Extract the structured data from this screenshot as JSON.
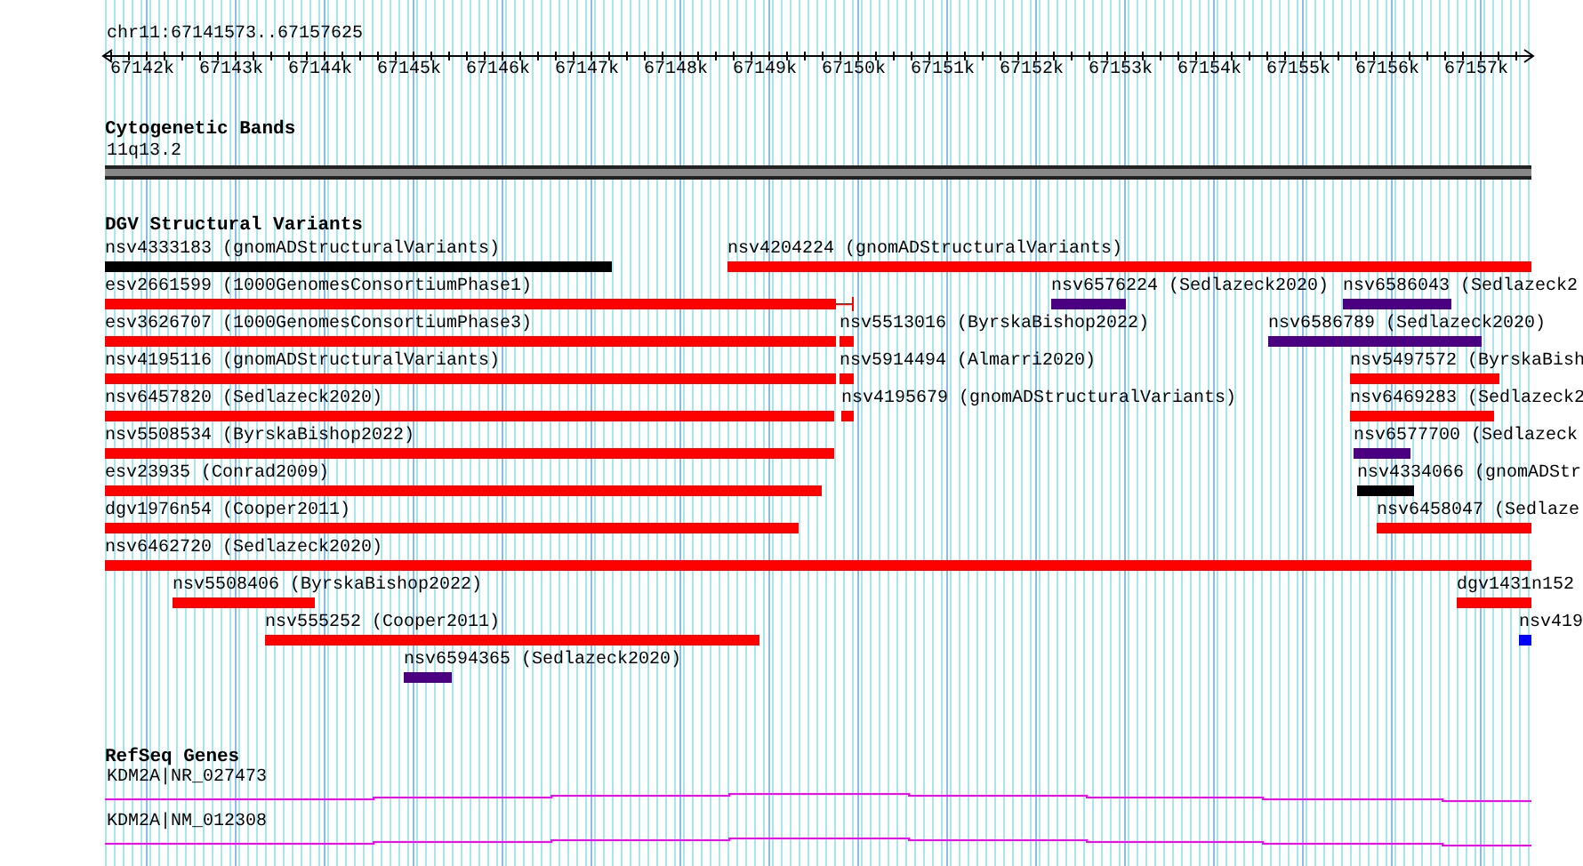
{
  "ruler": {
    "location": "chr11:67141573..67157625",
    "ticks": [
      "67142k",
      "67143k",
      "67144k",
      "67145k",
      "67146k",
      "67147k",
      "67148k",
      "67149k",
      "67150k",
      "67151k",
      "67152k",
      "67153k",
      "67154k",
      "67155k",
      "67156k",
      "67157k"
    ]
  },
  "cytobands": {
    "title": "Cytogenetic Bands",
    "band": "11q13.2"
  },
  "variants": {
    "title": "DGV Structural Variants",
    "features": [
      {
        "label": "nsv4333183 (gnomADStructuralVariants)",
        "color": "#000000",
        "kind": "bar"
      },
      {
        "label": "nsv4204224 (gnomADStructuralVariants)",
        "color": "#ff0000",
        "kind": "bar"
      },
      {
        "label": "esv2661599 (1000GenomesConsortiumPhase1)",
        "color": "#ff0000",
        "kind": "capped"
      },
      {
        "label": "nsv6576224 (Sedlazeck2020)",
        "color": "#4b0082",
        "kind": "bar"
      },
      {
        "label": "nsv6586043 (Sedlazeck2",
        "color": "#4b0082",
        "kind": "bar"
      },
      {
        "label": "esv3626707 (1000GenomesConsortiumPhase3)",
        "color": "#ff0000",
        "kind": "bar"
      },
      {
        "label": "nsv5513016 (ByrskaBishop2022)",
        "color": "#ff0000",
        "kind": "bar"
      },
      {
        "label": "nsv6586789 (Sedlazeck2020)",
        "color": "#4b0082",
        "kind": "bar"
      },
      {
        "label": "nsv4195116 (gnomADStructuralVariants)",
        "color": "#ff0000",
        "kind": "bar"
      },
      {
        "label": "nsv5914494 (Almarri2020)",
        "color": "#ff0000",
        "kind": "bar"
      },
      {
        "label": "nsv5497572 (ByrskaBish",
        "color": "#ff0000",
        "kind": "bar"
      },
      {
        "label": "nsv6457820 (Sedlazeck2020)",
        "color": "#ff0000",
        "kind": "bar"
      },
      {
        "label": "nsv4195679 (gnomADStructuralVariants)",
        "color": "#ff0000",
        "kind": "bar"
      },
      {
        "label": "nsv6469283 (Sedlazeck2",
        "color": "#ff0000",
        "kind": "bar"
      },
      {
        "label": "nsv5508534 (ByrskaBishop2022)",
        "color": "#ff0000",
        "kind": "bar"
      },
      {
        "label": "nsv6577700 (Sedlazeck",
        "color": "#4b0082",
        "kind": "bar"
      },
      {
        "label": "esv23935 (Conrad2009)",
        "color": "#ff0000",
        "kind": "bar"
      },
      {
        "label": "nsv4334066 (gnomADStr",
        "color": "#000000",
        "kind": "bar"
      },
      {
        "label": "dgv1976n54 (Cooper2011)",
        "color": "#ff0000",
        "kind": "bar"
      },
      {
        "label": "nsv6458047 (Sedlaze",
        "color": "#ff0000",
        "kind": "bar"
      },
      {
        "label": "nsv6462720 (Sedlazeck2020)",
        "color": "#ff0000",
        "kind": "bar"
      },
      {
        "label": "nsv5508406 (ByrskaBishop2022)",
        "color": "#ff0000",
        "kind": "bar"
      },
      {
        "label": "dgv1431n152",
        "color": "#ff0000",
        "kind": "bar"
      },
      {
        "label": "nsv555252 (Cooper2011)",
        "color": "#ff0000",
        "kind": "bar"
      },
      {
        "label": "nsv419",
        "color": "#0000ff",
        "kind": "bar"
      },
      {
        "label": "nsv6594365 (Sedlazeck2020)",
        "color": "#4b0082",
        "kind": "bar"
      }
    ]
  },
  "genes": {
    "title": "RefSeq Genes",
    "transcripts": [
      {
        "label": "KDM2A|NR_027473"
      },
      {
        "label": "KDM2A|NM_012308"
      }
    ]
  }
}
